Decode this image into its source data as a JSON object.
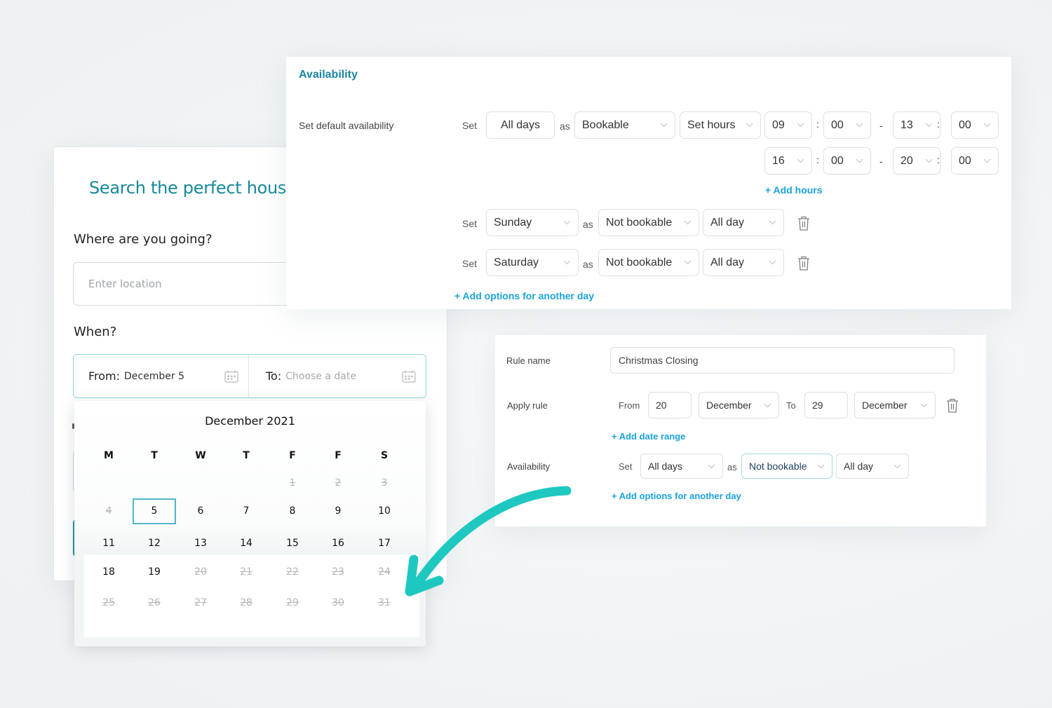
{
  "search_card": {
    "title": "Search the perfect house for",
    "where_label": "Where are you going?",
    "location_placeholder": "Enter location",
    "when_label": "When?",
    "from_key": "From:",
    "from_value": "December 5",
    "to_key": "To:",
    "to_placeholder": "Choose a date",
    "calendar_icon": "calendar-icon"
  },
  "calendar": {
    "month_title": "December 2021",
    "weekdays": [
      "M",
      "T",
      "W",
      "T",
      "F",
      "F",
      "S"
    ],
    "selected_day": 5,
    "weeks": [
      [
        null,
        null,
        null,
        null,
        {
          "d": "1",
          "disabled": true
        },
        {
          "d": "2",
          "disabled": true
        },
        {
          "d": "3",
          "disabled": true
        }
      ],
      [
        {
          "d": "4",
          "disabled": true
        },
        {
          "d": "5",
          "selected": true
        },
        {
          "d": "6"
        },
        {
          "d": "7"
        },
        {
          "d": "8"
        },
        {
          "d": "9"
        },
        {
          "d": "10"
        }
      ],
      [
        {
          "d": "11"
        },
        {
          "d": "12"
        },
        {
          "d": "13"
        },
        {
          "d": "14"
        },
        {
          "d": "15"
        },
        {
          "d": "16"
        },
        {
          "d": "17"
        }
      ],
      [
        {
          "d": "18"
        },
        {
          "d": "19"
        },
        {
          "d": "20",
          "disabled": true
        },
        {
          "d": "21",
          "disabled": true
        },
        {
          "d": "22",
          "disabled": true
        },
        {
          "d": "23",
          "disabled": true
        },
        {
          "d": "24",
          "disabled": true
        }
      ],
      [
        {
          "d": "25",
          "disabled": true
        },
        {
          "d": "26",
          "disabled": true
        },
        {
          "d": "27",
          "disabled": true
        },
        {
          "d": "28",
          "disabled": true
        },
        {
          "d": "29",
          "disabled": true
        },
        {
          "d": "30",
          "disabled": true
        },
        {
          "d": "31",
          "disabled": true
        }
      ]
    ]
  },
  "availability": {
    "title": "Availability",
    "default_label": "Set default availability",
    "set_word": "Set",
    "as_word": "as",
    "default_days": "All days",
    "default_status": "Bookable",
    "default_hours_mode": "Set hours",
    "hour_ranges": [
      {
        "from_h": "09",
        "from_m": "00",
        "to_h": "13",
        "to_m": "00"
      },
      {
        "from_h": "16",
        "from_m": "00",
        "to_h": "20",
        "to_m": "00"
      }
    ],
    "colon": ":",
    "dash": "-",
    "add_hours": "+ Add hours",
    "day_rules": [
      {
        "day": "Sunday",
        "status": "Not bookable",
        "hours": "All day"
      },
      {
        "day": "Saturday",
        "status": "Not bookable",
        "hours": "All day"
      }
    ],
    "add_day": "+ Add options for another day"
  },
  "rule": {
    "name_label": "Rule name",
    "name_value": "Christmas Closing",
    "apply_label": "Apply rule",
    "from_word": "From",
    "from_day": "20",
    "from_month": "December",
    "to_word": "To",
    "to_day": "29",
    "to_month": "December",
    "add_range": "+ Add date range",
    "availability_label": "Availability",
    "set_word": "Set",
    "as_word": "as",
    "days": "All days",
    "status": "Not bookable",
    "hours": "All day",
    "add_day": "+ Add options for another day"
  },
  "colors": {
    "brand_teal": "#15899a",
    "link_blue": "#1aa3d9",
    "arrow_teal": "#1ec8c0",
    "selected_border": "#4fb8c6"
  }
}
